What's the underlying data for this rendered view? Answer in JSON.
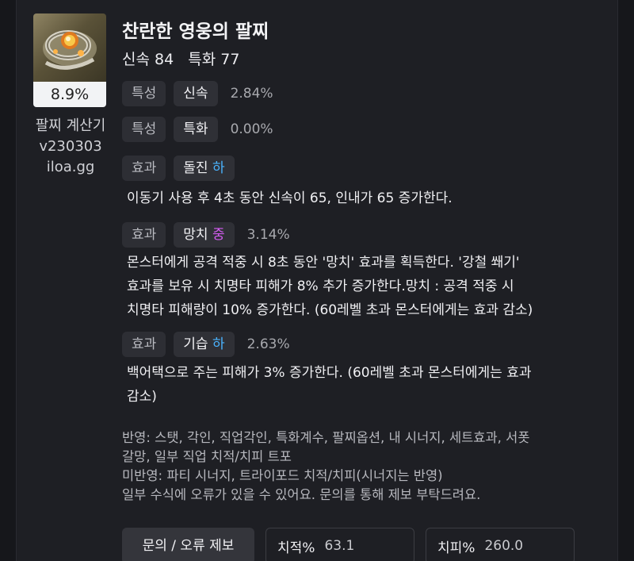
{
  "item": {
    "name": "찬란한 영웅의 팔찌",
    "stats": "신속 84   특화 77",
    "percent": "8.9%",
    "calc_title": "팔찌 계산기",
    "calc_version": "v230303",
    "calc_site": "iloa.gg"
  },
  "options": [
    {
      "type": "특성",
      "name": "신속",
      "grade": "",
      "value": "2.84%"
    },
    {
      "type": "특성",
      "name": "특화",
      "grade": "",
      "value": "0.00%"
    },
    {
      "type": "효과",
      "name": "돌진",
      "grade": "하",
      "value": "",
      "desc": [
        "이동기 사용 후 4초 동안 신속이 65, 인내가 65 증가한다."
      ]
    },
    {
      "type": "효과",
      "name": "망치",
      "grade": "중",
      "value": "3.14%",
      "desc": [
        "몬스터에게 공격 적중 시 8초 동안 '망치' 효과를 획득한다. '강철 쐐기'",
        "효과를 보유 시 치명타 피해가 8% 추가 증가한다.망치 : 공격 적중 시",
        "치명타 피해량이 10% 증가한다. (60레벨 초과 몬스터에게는 효과 감소)"
      ]
    },
    {
      "type": "효과",
      "name": "기습",
      "grade": "하",
      "value": "2.63%",
      "desc": [
        "백어택으로 주는 피해가 3% 증가한다. (60레벨 초과 몬스터에게는 효과",
        "감소)"
      ]
    }
  ],
  "notes": [
    "반영: 스탯, 각인, 직업각인, 특화계수, 팔찌옵션, 내 시너지, 세트효과, 서폿",
    "갈망, 일부 직업 치적/치피 트포",
    "미반영: 파티 시너지, 트라이포드 치적/치피(시너지는 반영)",
    "일부 수식에 오류가 있을 수 있어요. 문의를 통해 제보 부탁드려요."
  ],
  "footer": {
    "report_label": "문의 / 오류 제보",
    "crit_rate_label": "치적%",
    "crit_rate_value": "63.1",
    "crit_dmg_label": "치피%",
    "crit_dmg_value": "260.0"
  },
  "colors": {
    "grade_low": "#4ab3ff",
    "grade_mid": "#d45cf2"
  },
  "icons": {
    "item": "bracelet-item-icon"
  }
}
